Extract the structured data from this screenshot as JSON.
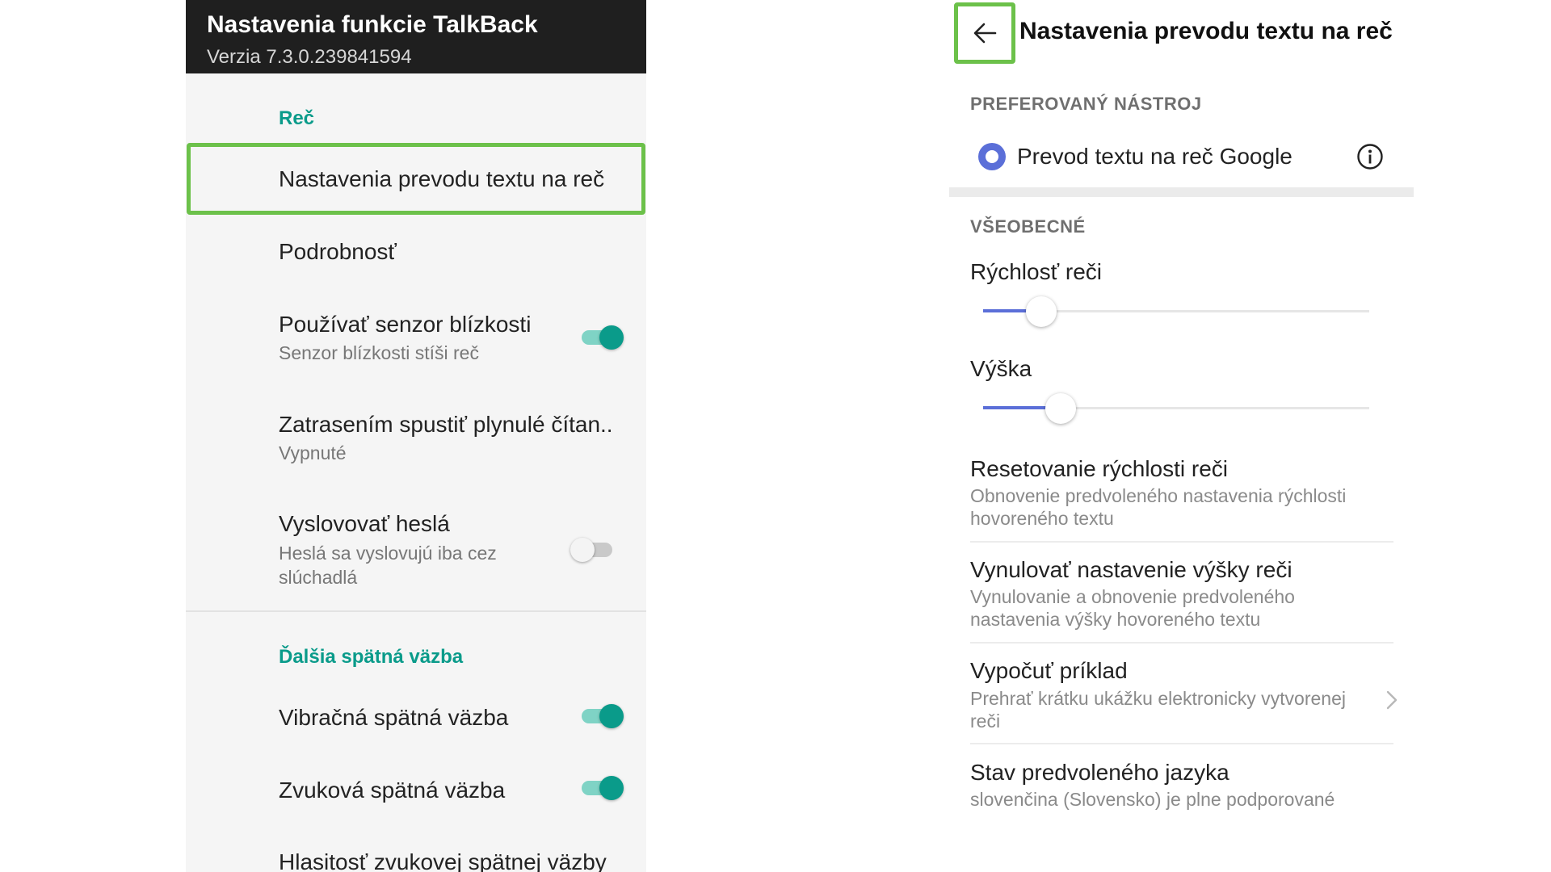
{
  "left": {
    "header": {
      "title": "Nastavenia funkcie TalkBack",
      "version": "Verzia 7.3.0.239841594"
    },
    "section_speech": "Reč",
    "items": [
      {
        "title": "Nastavenia prevodu textu na reč"
      },
      {
        "title": "Podrobnosť"
      },
      {
        "title": "Používať senzor blízkosti",
        "summary": "Senzor blízkosti stíši reč",
        "toggle": "on"
      },
      {
        "title": "Zatrasením spustiť plynulé čítan..",
        "summary": "Vypnuté"
      },
      {
        "title": "Vyslovovať heslá",
        "summary": "Heslá sa vyslovujú iba cez slúchadlá",
        "toggle": "off"
      }
    ],
    "section_feedback": "Ďalšia spätná väzba",
    "feedback_items": [
      {
        "title": "Vibračná spätná väzba",
        "toggle": "on"
      },
      {
        "title": "Zvuková spätná väzba",
        "toggle": "on"
      },
      {
        "title": "Hlasitosť zvukovej spätnej väzby"
      }
    ]
  },
  "right": {
    "title": "Nastavenia prevodu textu na reč",
    "preferred_header": "PREFEROVANÝ NÁSTROJ",
    "engine_label": "Prevod textu na reč Google",
    "general_header": "VŠEOBECNÉ",
    "rate_label": "Rýchlosť reči",
    "rate_value": 0.15,
    "pitch_label": "Výška",
    "pitch_value": 0.2,
    "items": [
      {
        "title": "Resetovanie rýchlosti reči",
        "summary": "Obnovenie predvoleného nastavenia rýchlosti hovoreného textu"
      },
      {
        "title": "Vynulovať nastavenie výšky reči",
        "summary": "Vynulovanie a obnovenie predvoleného nastavenia výšky hovoreného textu"
      },
      {
        "title": "Vypočuť príklad",
        "summary": "Prehrať krátku ukážku elektronicky vytvorenej reči"
      },
      {
        "title": "Stav predvoleného jazyka",
        "summary": "slovenčina (Slovensko) je plne podporované"
      }
    ]
  },
  "colors": {
    "accent": "#0a9b8a",
    "highlight": "#6cc14a",
    "radio": "#5b6fd8",
    "appbar": "#1f1f1f"
  }
}
